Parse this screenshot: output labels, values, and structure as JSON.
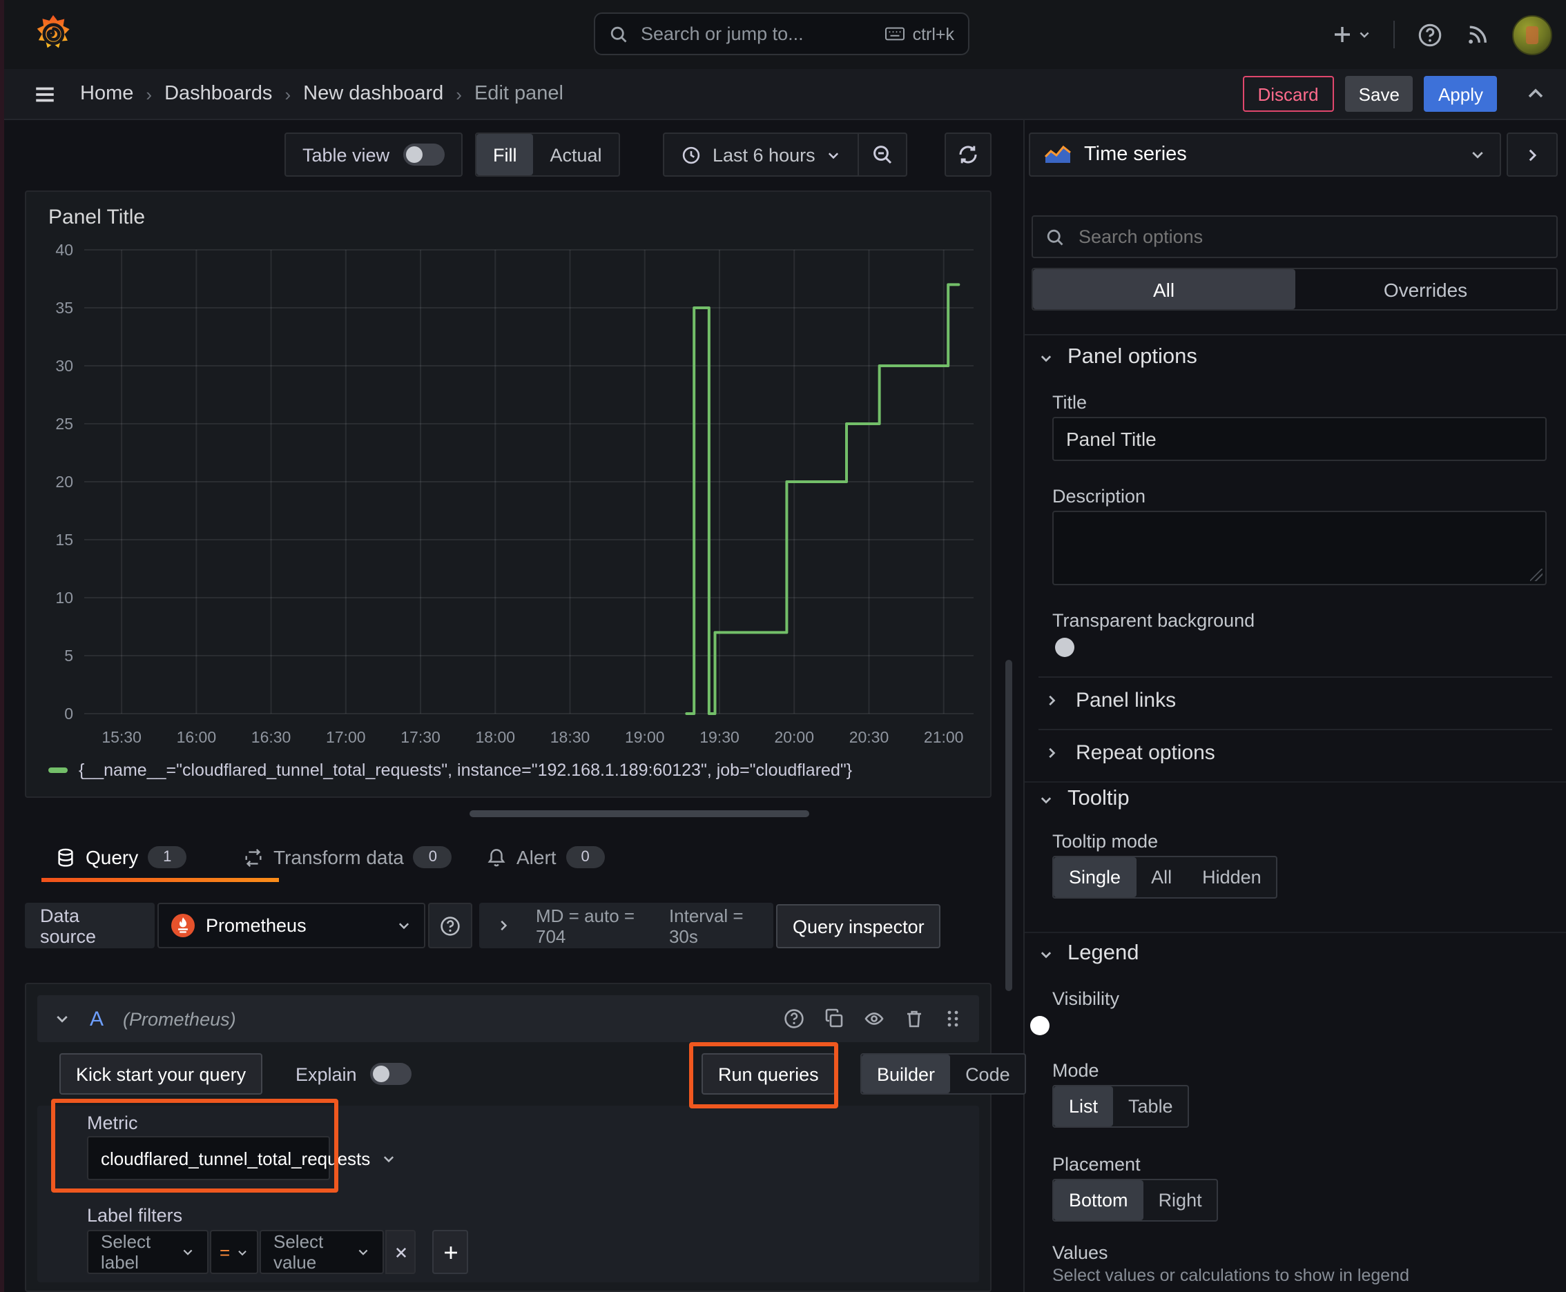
{
  "topbar": {
    "search_placeholder": "Search or jump to...",
    "shortcut": "ctrl+k"
  },
  "breadcrumb": {
    "items": [
      "Home",
      "Dashboards",
      "New dashboard",
      "Edit panel"
    ],
    "discard": "Discard",
    "save": "Save",
    "apply": "Apply"
  },
  "toolbar": {
    "table_view": "Table view",
    "fill": "Fill",
    "actual": "Actual",
    "time_range": "Last 6 hours"
  },
  "panel": {
    "title": "Panel Title"
  },
  "chart_data": {
    "type": "line",
    "line_interpolation": "step-after",
    "title": "Panel Title",
    "xlabel": "",
    "ylabel": "",
    "xlim": [
      15.25,
      21.2
    ],
    "ylim": [
      0,
      40
    ],
    "grid": true,
    "legend_position": "bottom",
    "yticks": [
      0,
      5,
      10,
      15,
      20,
      25,
      30,
      35,
      40
    ],
    "xticks": [
      {
        "v": 15.5,
        "label": "15:30"
      },
      {
        "v": 16.0,
        "label": "16:00"
      },
      {
        "v": 16.5,
        "label": "16:30"
      },
      {
        "v": 17.0,
        "label": "17:00"
      },
      {
        "v": 17.5,
        "label": "17:30"
      },
      {
        "v": 18.0,
        "label": "18:00"
      },
      {
        "v": 18.5,
        "label": "18:30"
      },
      {
        "v": 19.0,
        "label": "19:00"
      },
      {
        "v": 19.5,
        "label": "19:30"
      },
      {
        "v": 20.0,
        "label": "20:00"
      },
      {
        "v": 20.5,
        "label": "20:30"
      },
      {
        "v": 21.0,
        "label": "21:00"
      }
    ],
    "series": [
      {
        "name": "{__name__=\"cloudflared_tunnel_total_requests\", instance=\"192.168.1.189:60123\", job=\"cloudflared\"}",
        "color": "#73bf69",
        "points": [
          [
            19.28,
            0
          ],
          [
            19.33,
            35
          ],
          [
            19.43,
            0
          ],
          [
            19.47,
            7
          ],
          [
            19.95,
            20
          ],
          [
            20.35,
            25
          ],
          [
            20.57,
            30
          ],
          [
            21.03,
            37
          ],
          [
            21.1,
            37
          ]
        ]
      }
    ]
  },
  "tabs": {
    "query": "Query",
    "query_count": "1",
    "transform": "Transform data",
    "transform_count": "0",
    "alert": "Alert",
    "alert_count": "0"
  },
  "query": {
    "datasource_label": "Data source",
    "datasource_value": "Prometheus",
    "stats_md": "MD = auto = 704",
    "stats_interval": "Interval = 30s",
    "inspector": "Query inspector",
    "ref_id": "A",
    "ref_note": "(Prometheus)",
    "kickstart": "Kick start your query",
    "explain": "Explain",
    "run_queries": "Run queries",
    "builder": "Builder",
    "code": "Code",
    "metric_label": "Metric",
    "metric_value": "cloudflared_tunnel_total_requests",
    "label_filters": "Label filters",
    "select_label": "Select label",
    "operator": "=",
    "select_value": "Select value",
    "remove": "x",
    "add": "+"
  },
  "sidebar": {
    "viz_type": "Time series",
    "search_placeholder": "Search options",
    "filter_all": "All",
    "filter_overrides": "Overrides",
    "panel_options": "Panel options",
    "title_label": "Title",
    "title_value": "Panel Title",
    "description_label": "Description",
    "transparent_label": "Transparent background",
    "panel_links": "Panel links",
    "repeat_options": "Repeat options",
    "tooltip": "Tooltip",
    "tooltip_mode": "Tooltip mode",
    "tooltip_single": "Single",
    "tooltip_all": "All",
    "tooltip_hidden": "Hidden",
    "legend": "Legend",
    "visibility": "Visibility",
    "mode": "Mode",
    "mode_list": "List",
    "mode_table": "Table",
    "placement": "Placement",
    "placement_bottom": "Bottom",
    "placement_right": "Right",
    "values": "Values",
    "values_hint": "Select values or calculations to show in legend"
  },
  "colors": {
    "series_green": "#73bf69",
    "accent_orange": "#f0581f",
    "tab_orange": "#f2521b",
    "primary_blue": "#3d71d9"
  }
}
